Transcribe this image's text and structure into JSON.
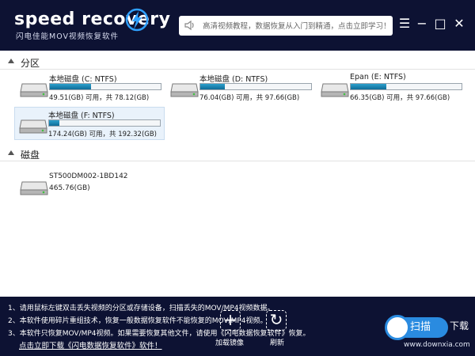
{
  "header": {
    "logo_text": "speed recovery",
    "subtitle": "闪电佳能MOV视频恢复软件",
    "notice": "高清视频教程，数据恢复从入门到精通，点击立即学习！",
    "menu_glyph": "☰",
    "minimize_glyph": "−",
    "maximize_glyph": "□",
    "close_glyph": "✕"
  },
  "partitions": {
    "title": "分区",
    "items": [
      {
        "name": "本地磁盘 (C: NTFS)",
        "capacity": "49.51(GB) 可用，共 78.12(GB)",
        "used_fraction": 0.37
      },
      {
        "name": "本地磁盘 (D: NTFS)",
        "capacity": "76.04(GB) 可用，共 97.66(GB)",
        "used_fraction": 0.22
      },
      {
        "name": "Epan (E: NTFS)",
        "capacity": "66.35(GB) 可用，共 97.66(GB)",
        "used_fraction": 0.32
      },
      {
        "name": "本地磁盘 (F: NTFS)",
        "capacity": "174.24(GB) 可用，共 192.32(GB)",
        "used_fraction": 0.09
      }
    ]
  },
  "disks": {
    "title": "磁盘",
    "items": [
      {
        "name": "ST500DM002-1BD142",
        "size": "465.76(GB)"
      }
    ]
  },
  "footer": {
    "tips": [
      "1、请用鼠标左键双击丢失视频的分区或存储设备，扫描丢失的MOV/MP4视频数据。",
      "2、本软件使用碎片重组技术，恢复一般数据恢复软件不能恢复的MOV/MP4视频。",
      "3、本软件只恢复MOV/MP4视频。如果需要恢复其他文件，请使用《闪电数据恢复软件》恢复。"
    ],
    "link": "点击立即下载《闪电数据恢复软件》软件！",
    "load_image_label": "加载镜像",
    "load_image_glyph": "+",
    "refresh_label": "刷新",
    "refresh_glyph": "↻"
  },
  "watermark": {
    "button": "扫描",
    "tag": "下载",
    "url": "www.downxia.com"
  },
  "colors": {
    "header_bg": "#0d1233",
    "progress_fill": "#1a86b6",
    "accent_blue": "#2a8be0"
  }
}
